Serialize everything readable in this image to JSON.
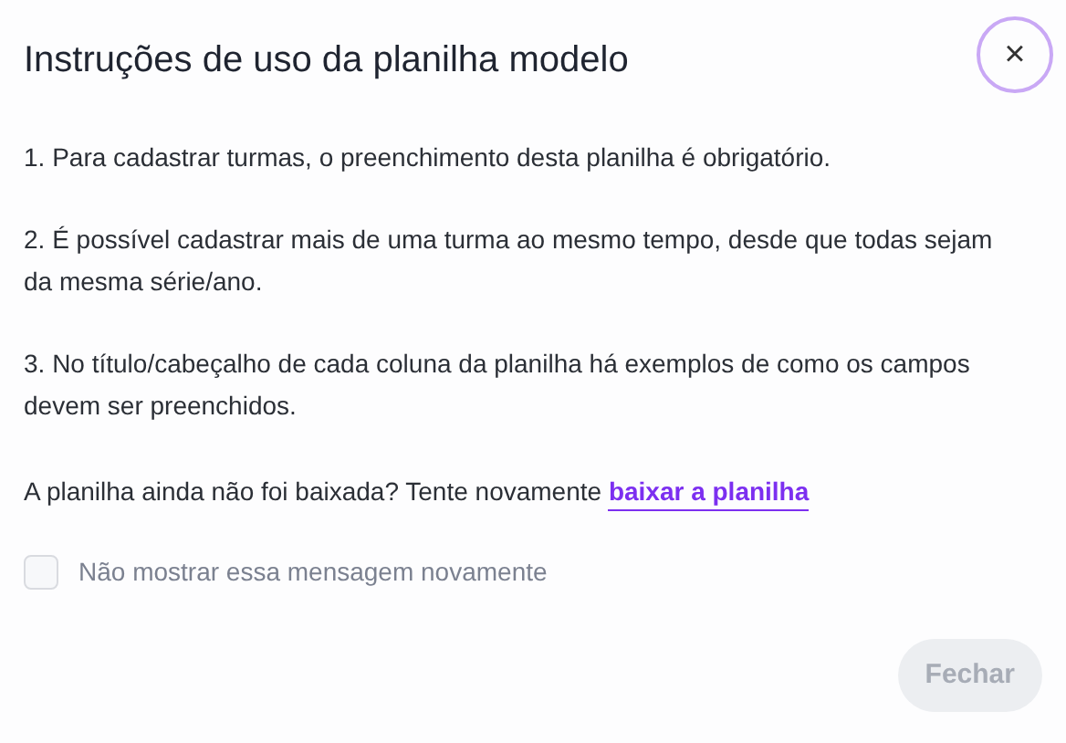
{
  "dialog": {
    "title": "Instruções de uso da planilha modelo",
    "close_button": "×",
    "paragraphs": [
      "1. Para cadastrar turmas, o preenchimento desta planilha é obrigatório.",
      "2. É possível cadastrar mais de uma turma ao mesmo tempo, desde que todas sejam da mesma série/ano.",
      "3. No título/cabeçalho de cada coluna da planilha há exemplos de como os campos devem ser preenchidos."
    ],
    "retry_text": "A planilha ainda não foi baixada? Tente novamente",
    "retry_link": "baixar a planilha",
    "checkbox": {
      "label": "Não mostrar essa mensagem novamente",
      "checked": false
    },
    "button": {
      "label": "Fechar",
      "disabled": true
    }
  }
}
